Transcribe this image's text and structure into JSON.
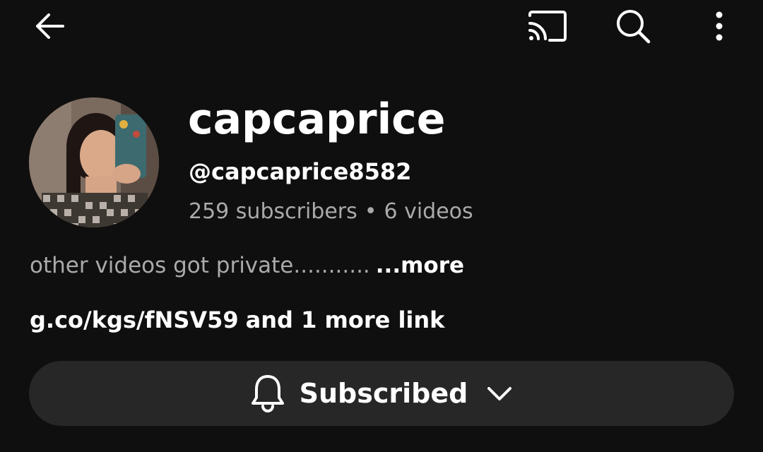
{
  "topbar": {
    "back_icon": "arrow-left-icon",
    "cast_icon": "cast-icon",
    "search_icon": "search-icon",
    "more_icon": "more-vert-icon"
  },
  "channel": {
    "name": "capcaprice",
    "handle": "@capcaprice8582",
    "subscribers": "259 subscribers",
    "separator": "•",
    "videos": "6 videos",
    "description": "other videos got private...........",
    "more_label": "...more",
    "link_url": "g.co/kgs/fNSV59",
    "link_more": "and 1 more link"
  },
  "subscribe": {
    "label": "Subscribed",
    "bell_icon": "bell-icon",
    "chevron_icon": "chevron-down-icon"
  },
  "colors": {
    "background": "#0f0f0f",
    "button_bg": "#272727",
    "secondary_text": "#aaaaaa",
    "primary_text": "#ffffff"
  }
}
